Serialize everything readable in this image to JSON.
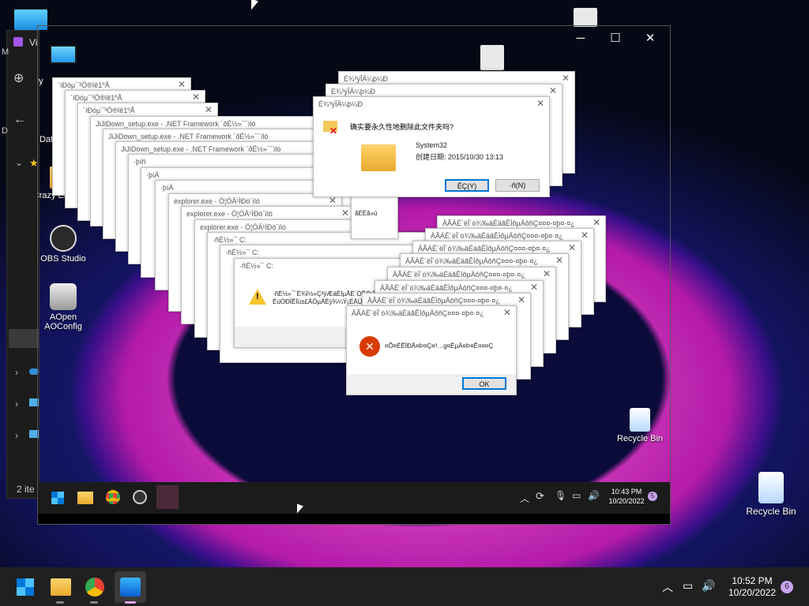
{
  "desktop": {
    "recycle_bin": "Recycle Bin"
  },
  "left_panel": {
    "title_fragment": "Vi",
    "item_count": "2 ite",
    "side_letters": [
      "M",
      "D"
    ]
  },
  "vm_desktop": {
    "icons": [
      {
        "label": "My",
        "icon": "monitor-icon"
      },
      {
        "label": "Dat",
        "icon": "folder-icon"
      },
      {
        "label": "Crazy Error.exe",
        "icon": "folder-icon"
      },
      {
        "label": "OBS Studio",
        "icon": "obs-icon"
      },
      {
        "label": "AOpen AOConfig",
        "icon": "aopen-icon"
      }
    ],
    "recycle_bin": "Recycle Bin"
  },
  "dialogs": {
    "garbled_1": "´íÐóµ¯³Ö®îê1ºÅ",
    "garbled_2": "´íÐóµ¯³Ö®îê1ºÅ",
    "garbled_3": "´íÐóµ¯³Ö®îê1ºÅ",
    "jijidown_1": "JiJiDown_setup.exe - .NET Framework ´ðÉ½»¯´ïló",
    "jijidown_2": "JiJiDown_setup.exe - .NET Framework ´ðÉ½»¯´ïló",
    "jijidown_3": "JiJiDown_setup.exe - .NET Framework ´ðÉ½»¯´ïló",
    "pia_1": "·þíñ",
    "pia_2": "·þíÄ",
    "pia_3": "·þíÄ",
    "explorer_1": "explorer.exe - Ö¦ÓÄ¹ÌÐò´ïló",
    "explorer_2": "explorer.exe - Ö¦ÓÄ¹ÌÐò´ïló",
    "explorer_3": "explorer.exe - Ö¦ÓÄ¹ÌÐò´ïló",
    "c_1": "·ñÉ½»¯ C:",
    "c_2": "·ñÉ½»¯ C:",
    "c_3": "·ñÉ½»¯ C:",
    "warn_text_1": "·ñÉ½»¯´É¾Í½«Ç³ÿÆäÉÍµÂÈ´ÓÊÓ¡ÎÊÐ±¾ÂÝ¡Â»¡Ó¡",
    "warn_text_2": "ÉüÓÐÍÊÍü±£ÄÓµÄÉý¾¼Ý¡ÉÄÜ",
    "delete_title_1": "É¾³ýÎÄ¼þ¼Ð",
    "delete_title_2": "É¾³ýÎÄ¼þ¼Ð",
    "delete_title_3": "É¾³ýÎÄ¼þ¼Ð",
    "delete_question": "确实要永久性地删除此文件夹吗?",
    "folder_name": "System32",
    "folder_date": "创建日期: 2015/10/30 13:13",
    "btn_yes": "ÊÇ(Y)",
    "btn_no": "·ñ(N)",
    "partial_text": "ãÉÉã»ú",
    "stack_title": "ÄÃÁË´ëÎ´ó¾‰äÉäãÊÌõµÄôñÇ¤¤¤-¤þ¤·¤¿",
    "error_title": "ÄÃÁË´ëÎ´ó¾‰äÉäãÊÌõµÄôñÇ¤¤¤-¤þ¤·¤¿",
    "error_message": "¤Ô¤ÉÊÌÐÂ¤Þ¤Ç¤³…g¤ËµÄ¤Þ¤Ê¤¤¤Ç",
    "btn_ok": "OK"
  },
  "vm_taskbar": {
    "time": "10:43 PM",
    "date": "10/20/2022",
    "badge": "5"
  },
  "taskbar": {
    "time": "10:52 PM",
    "date": "10/20/2022",
    "badge": "6"
  },
  "colors": {
    "accent": "#0078d7",
    "error": "#d83b01",
    "warning": "#f7c52b",
    "badge": "#c8a4f0"
  }
}
